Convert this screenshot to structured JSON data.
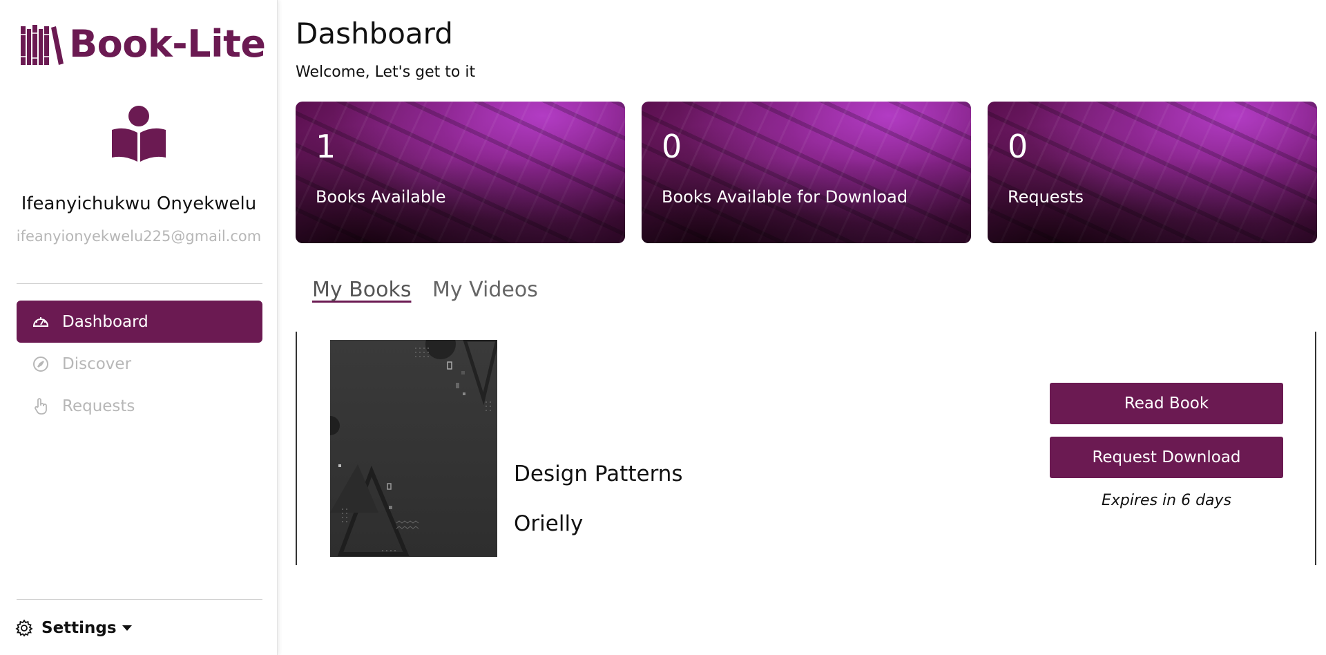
{
  "app": {
    "name": "Book-Lite",
    "brand_color": "#6b1a52"
  },
  "user": {
    "name": "Ifeanyichukwu Onyekwelu",
    "email": "ifeanyionyekwelu225@gmail.com"
  },
  "sidebar": {
    "items": [
      {
        "label": "Dashboard",
        "icon": "speedometer-icon",
        "active": true
      },
      {
        "label": "Discover",
        "icon": "compass-icon",
        "active": false
      },
      {
        "label": "Requests",
        "icon": "hand-pointer-icon",
        "active": false
      }
    ],
    "settings_label": "Settings"
  },
  "header": {
    "title": "Dashboard",
    "subtitle": "Welcome, Let's get to it"
  },
  "stats": [
    {
      "value": "1",
      "label": "Books Available"
    },
    {
      "value": "0",
      "label": "Books Available for Download"
    },
    {
      "value": "0",
      "label": "Requests"
    }
  ],
  "tabs": [
    {
      "label": "My Books",
      "active": true
    },
    {
      "label": "My Videos",
      "active": false
    }
  ],
  "books": [
    {
      "title": "Design Patterns",
      "author": "Orielly",
      "read_label": "Read Book",
      "download_label": "Request Download",
      "expires": "Expires in 6 days"
    }
  ]
}
